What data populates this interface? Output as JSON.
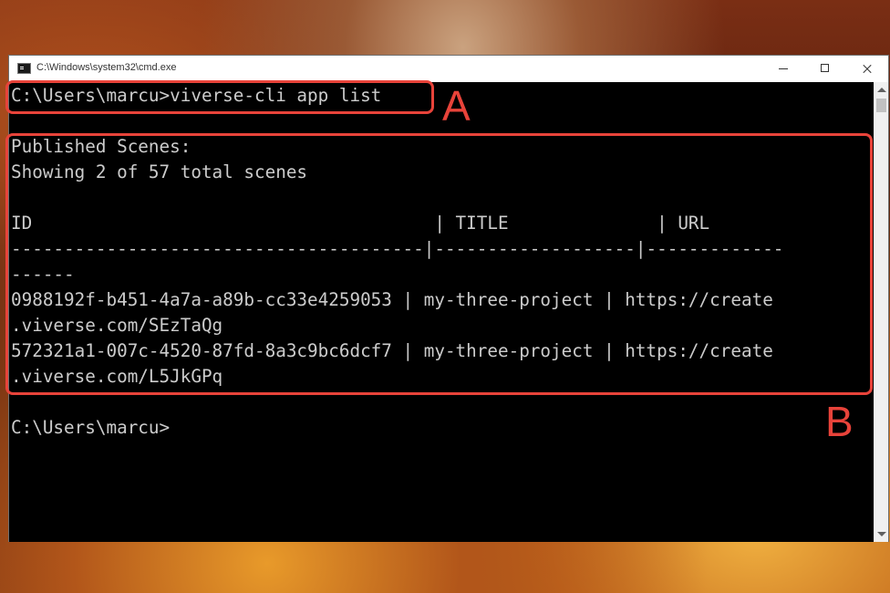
{
  "window": {
    "title": "C:\\Windows\\system32\\cmd.exe"
  },
  "console": {
    "lines": [
      "C:\\Users\\marcu>viverse-cli app list",
      "",
      "Published Scenes:",
      "Showing 2 of 57 total scenes",
      "",
      "ID                                      | TITLE              | URL",
      "---------------------------------------|-------------------|-------------",
      "------",
      "0988192f-b451-4a7a-a89b-cc33e4259053 | my-three-project | https://create",
      ".viverse.com/SEzTaQg",
      "572321a1-007c-4520-87fd-8a3c9bc6dcf7 | my-three-project | https://create",
      ".viverse.com/L5JkGPq",
      "",
      "C:\\Users\\marcu>"
    ]
  },
  "annotations": {
    "a_label": "A",
    "b_label": "B",
    "color": "#e8433a"
  }
}
